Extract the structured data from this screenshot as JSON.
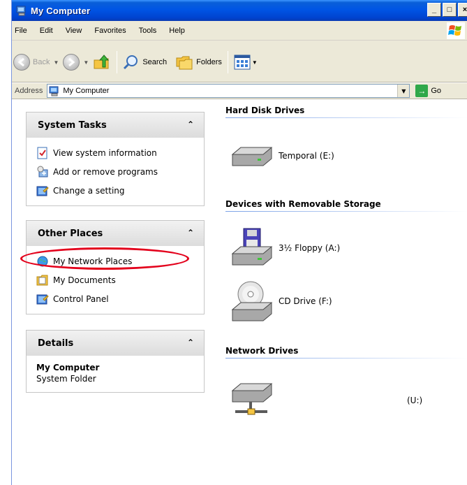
{
  "window": {
    "title": "My Computer"
  },
  "menu": [
    "File",
    "Edit",
    "View",
    "Favorites",
    "Tools",
    "Help"
  ],
  "toolbar": {
    "back_label": "Back",
    "search_label": "Search",
    "folders_label": "Folders"
  },
  "address": {
    "label": "Address",
    "value": "My Computer",
    "go_label": "Go"
  },
  "left_pane": {
    "system_tasks": {
      "title": "System Tasks",
      "items": [
        "View system information",
        "Add or remove programs",
        "Change a setting"
      ]
    },
    "other_places": {
      "title": "Other Places",
      "items": [
        "My Network Places",
        "My Documents",
        "Control Panel"
      ]
    },
    "details": {
      "title": "Details",
      "name": "My Computer",
      "type": "System Folder"
    }
  },
  "right_pane": {
    "hard_disk": {
      "title": "Hard Disk Drives",
      "drives": [
        {
          "label": "Temporal (E:)",
          "icon": "hard-drive-icon"
        }
      ]
    },
    "removable": {
      "title": "Devices with Removable Storage",
      "drives": [
        {
          "label": "3½ Floppy (A:)",
          "icon": "floppy-drive-icon"
        },
        {
          "label": "CD Drive (F:)",
          "icon": "cd-drive-icon"
        }
      ]
    },
    "network": {
      "title": "Network Drives",
      "drives": [
        {
          "label": "(U:)",
          "icon": "network-drive-icon"
        }
      ]
    }
  },
  "colors": {
    "titlebar": "#0055e5",
    "highlight_ring": "#e3001b",
    "go": "#2fa84a"
  }
}
